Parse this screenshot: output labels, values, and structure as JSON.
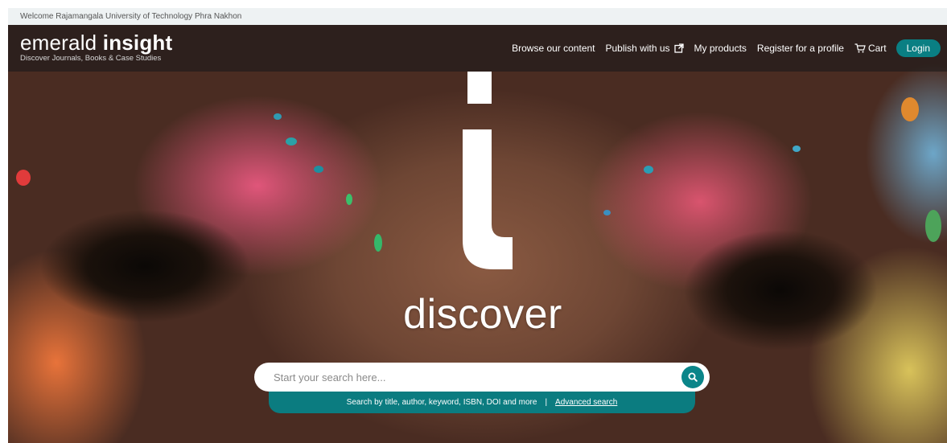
{
  "welcome": "Welcome Rajamangala University of Technology Phra Nakhon",
  "logo": {
    "word1": "emerald ",
    "word2": "insight",
    "tagline": "Discover Journals, Books & Case Studies"
  },
  "nav": {
    "browse": "Browse our content",
    "publish": "Publish with us",
    "products": "My products",
    "register": "Register for a profile",
    "cart": "Cart",
    "login": "Login"
  },
  "hero": {
    "heading": "discover"
  },
  "search": {
    "placeholder": "Start your search here...",
    "hint": "Search by title, author, keyword, ISBN, DOI and more",
    "separator": "|",
    "advanced": "Advanced search"
  },
  "colors": {
    "accent": "#0a7f83",
    "header": "#1c1a1a"
  },
  "icons": {
    "publish": "external-link-icon",
    "cart": "cart-icon",
    "search": "search-icon"
  }
}
